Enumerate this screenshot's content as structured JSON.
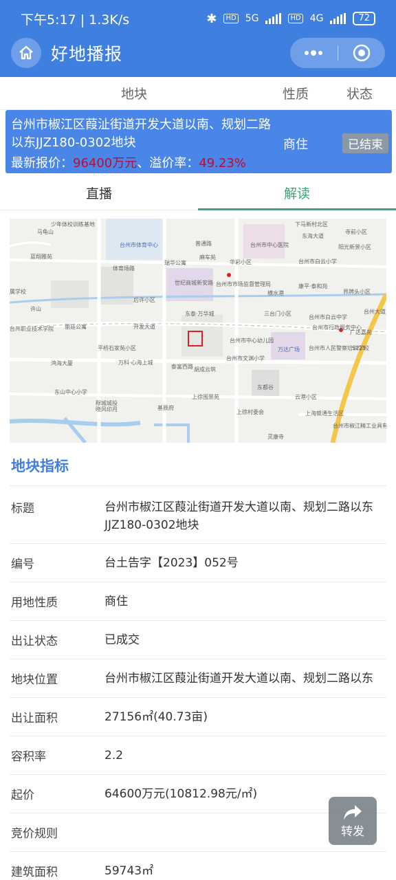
{
  "status_bar": {
    "time_speed": "下午5:17 | 1.3K/s",
    "hd1": "HD",
    "net1": "5G",
    "hd2": "HD",
    "net2": "4G",
    "battery": "72"
  },
  "header": {
    "title": "好地播报",
    "menu_icon": "more-dots-icon",
    "close_icon": "target-circle-icon"
  },
  "columns": {
    "parcel": "地块",
    "nature": "性质",
    "status": "状态"
  },
  "selected_item": {
    "title": "台州市椒江区葭沚街道开发大道以南、规划二路以东JJZ180-0302地块",
    "price_label": "最新报价：",
    "price_value": "96400万元",
    "premium_label": "、溢价率：",
    "premium_value": "49.23%",
    "nature": "商住",
    "status": "已结束"
  },
  "tabs": [
    {
      "label": "直播",
      "active": false
    },
    {
      "label": "解读",
      "active": true
    }
  ],
  "map": {
    "labels": [
      "少年体校训练基地",
      "马龟山",
      "台州市体育中心",
      "台州市中心医院",
      "下马新村北区",
      "寺前小区",
      "东海大道",
      "阳光新景小区",
      "蓝翔雅苑",
      "普通路",
      "瑞华公寓",
      "麻车苑",
      "华彩小区",
      "台州市白云小学",
      "体育场路",
      "世纪商城新安路",
      "台州市市场监督管理局",
      "属学校",
      "许山",
      "后许小区",
      "横水港",
      "康平·泰和苑",
      "界牌头小区",
      "东泰·万华城",
      "三台门小区",
      "台州市白云中学",
      "台州市行政服务中心",
      "广达嘉苑",
      "台州职业技术学院",
      "丽廷公寓",
      "开发大道",
      "台州市中心幼儿园",
      "万达广场",
      "台州市人民警察培训学校",
      "平桥石家苑小区",
      "鸿海大厦",
      "万科·心海上城",
      "泰富西路",
      "台州市文渊小学",
      "胡成云筑",
      "东都谷",
      "云港小区",
      "东山中心小学",
      "上徐围景苑",
      "穆城城投",
      "晓风印月",
      "基辰府",
      "上徐村委会",
      "上海赣通生活区",
      "台州市椒江精工业具有限公司",
      "灵康寺",
      "S225",
      "台州大道"
    ]
  },
  "section": {
    "title": "地块指标",
    "rows": [
      {
        "k": "标题",
        "v": "台州市椒江区葭沚街道开发大道以南、规划二路以东JJZ180-0302地块"
      },
      {
        "k": "编号",
        "v": "台土告字【2023】052号"
      },
      {
        "k": "用地性质",
        "v": "商住"
      },
      {
        "k": "出让状态",
        "v": "已成交"
      },
      {
        "k": "地块位置",
        "v": "台州市椒江区葭沚街道开发大道以南、规划二路以东"
      },
      {
        "k": "出让面积",
        "v": "27156㎡(40.73亩)"
      },
      {
        "k": "容积率",
        "v": "2.2"
      },
      {
        "k": "起价",
        "v": "64600万元(10812.98元/㎡)"
      },
      {
        "k": "竞价规则",
        "v": ""
      },
      {
        "k": "建筑面积",
        "v": "59743㎡"
      }
    ]
  },
  "share_button": {
    "label": "转发",
    "icon": "share-arrow-icon"
  },
  "colors": {
    "header": "#3f7fe0",
    "item_bg": "#4a86e8",
    "active_tab": "#3aa676",
    "price_red": "#c4092b"
  }
}
